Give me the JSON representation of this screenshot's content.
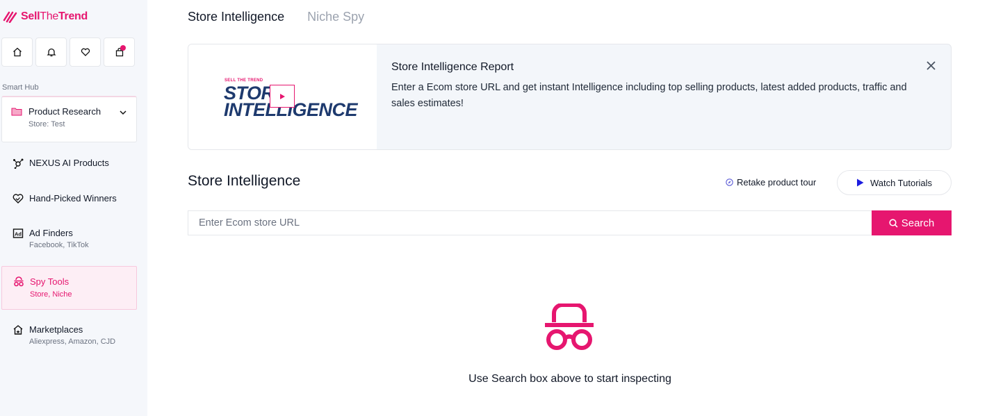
{
  "brand": {
    "name_part1": "Sell",
    "name_part2": "The",
    "name_part3": "Trend",
    "accent": "#e6166f"
  },
  "top_icons": [
    {
      "icon": "home-icon"
    },
    {
      "icon": "bell-icon"
    },
    {
      "icon": "heart-icon"
    },
    {
      "icon": "shopping-bag-icon",
      "badge": true
    }
  ],
  "sidebar": {
    "section_label": "Smart Hub",
    "product_research": {
      "title": "Product Research",
      "sub": "Store: Test"
    },
    "items": [
      {
        "title": "NEXUS AI Products",
        "sub": ""
      },
      {
        "title": "Hand-Picked Winners",
        "sub": ""
      },
      {
        "title": "Ad Finders",
        "sub": "Facebook, TikTok"
      },
      {
        "title": "Spy Tools",
        "sub": "Store, Niche"
      },
      {
        "title": "Marketplaces",
        "sub": "Aliexpress, Amazon, CJD"
      }
    ]
  },
  "tabs": {
    "active": "Store Intelligence",
    "inactive": "Niche Spy"
  },
  "banner": {
    "thumb_small": "SELL THE TREND",
    "thumb_line1": "STORE",
    "thumb_line2": "INTELLIGENCE",
    "title": "Store Intelligence Report",
    "description": "Enter a Ecom store URL and get instant Intelligence including top selling products, latest added products, traffic and sales estimates!"
  },
  "section_title": "Store Intelligence",
  "retake_tour": "Retake product tour",
  "watch_tutorials": "Watch Tutorials",
  "search": {
    "placeholder": "Enter Ecom store URL",
    "button": "Search"
  },
  "empty_state": "Use Search box above to start inspecting"
}
